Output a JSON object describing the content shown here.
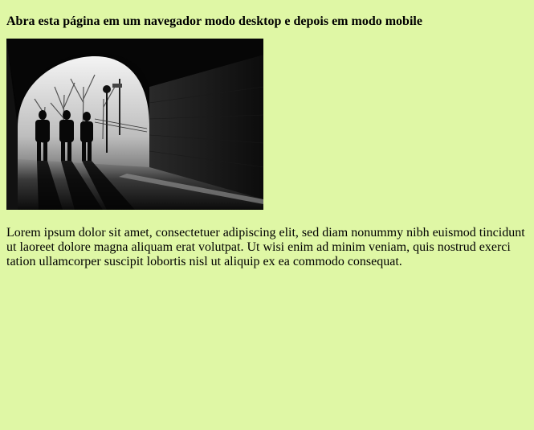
{
  "page": {
    "heading": "Abra esta página em um navegador modo desktop e depois em modo mobile",
    "image": {
      "alt": "Tunnel with people walking",
      "colors": {
        "background": "#dff7a5"
      }
    },
    "paragraph": "Lorem ipsum dolor sit amet, consectetuer adipiscing elit, sed diam nonummy nibh euismod tincidunt ut laoreet dolore magna aliquam erat volutpat. Ut wisi enim ad minim veniam, quis nostrud exerci tation ullamcorper suscipit lobortis nisl ut aliquip ex ea commodo consequat."
  }
}
